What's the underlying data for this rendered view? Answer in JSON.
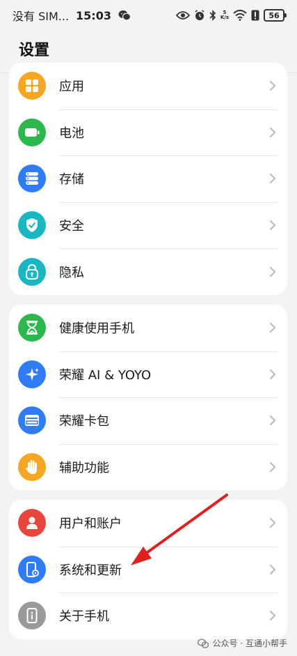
{
  "status_bar": {
    "carrier": "没有 SIM...",
    "time": "15:03",
    "speed_top": "5",
    "speed_bottom": "K/s",
    "battery": "56"
  },
  "header": {
    "title": "设置"
  },
  "groups": [
    {
      "items": [
        {
          "label": "应用",
          "icon": "apps-grid-icon",
          "color": "#f5a623"
        },
        {
          "label": "电池",
          "icon": "battery-icon",
          "color": "#2db84d"
        },
        {
          "label": "存储",
          "icon": "storage-icon",
          "color": "#2f7cf6"
        },
        {
          "label": "安全",
          "icon": "shield-icon",
          "color": "#1ab6c2"
        },
        {
          "label": "隐私",
          "icon": "privacy-lock-icon",
          "color": "#1ab6c2"
        }
      ]
    },
    {
      "items": [
        {
          "label": "健康使用手机",
          "icon": "hourglass-icon",
          "color": "#2db84d"
        },
        {
          "label": "荣耀 AI & YOYO",
          "icon": "sparkle-icon",
          "color": "#2f7cf6"
        },
        {
          "label": "荣耀卡包",
          "icon": "wallet-icon",
          "color": "#2f7cf6"
        },
        {
          "label": "辅助功能",
          "icon": "hand-icon",
          "color": "#f5a623"
        }
      ]
    },
    {
      "items": [
        {
          "label": "用户和账户",
          "icon": "user-icon",
          "color": "#e8453c"
        },
        {
          "label": "系统和更新",
          "icon": "system-update-icon",
          "color": "#2f7cf6"
        },
        {
          "label": "关于手机",
          "icon": "phone-info-icon",
          "color": "#9a9a9a"
        }
      ]
    }
  ],
  "watermark": {
    "text": "公众号 · 互通小帮手"
  },
  "colors": {
    "annotation_arrow": "#e02020",
    "background": "#f1f3f5"
  }
}
